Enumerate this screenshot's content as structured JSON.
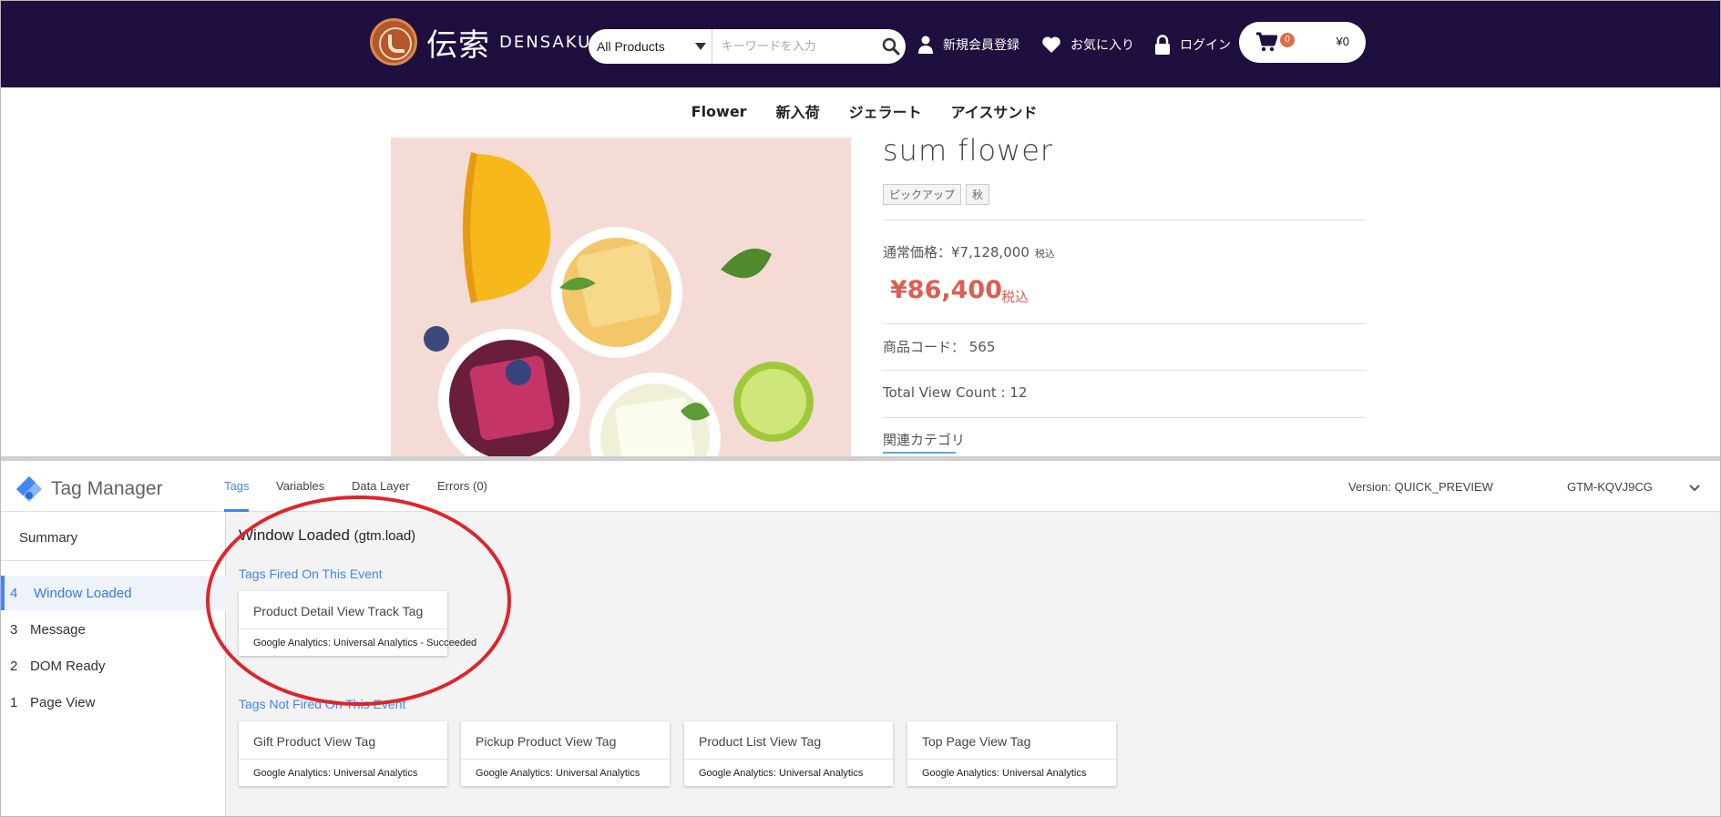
{
  "store": {
    "logo_text": "伝索",
    "logo_roman": "DENSAKU",
    "search": {
      "category": "All Products",
      "placeholder": "キーワードを入力"
    },
    "header_links": {
      "register": "新規会員登録",
      "favorites": "お気に入り",
      "login": "ログイン"
    },
    "cart": {
      "count": "0",
      "total": "¥0"
    },
    "nav": [
      "Flower",
      "新入荷",
      "ジェラート",
      "アイスサンド"
    ]
  },
  "product": {
    "name": "sum flower",
    "tags": [
      "ピックアップ",
      "秋"
    ],
    "regular_price": "通常価格：¥7,128,000",
    "regular_tax": "税込",
    "price": "¥86,400",
    "price_tax": "税込",
    "code": "商品コード： 565",
    "view_count": "Total View Count : 12",
    "related_label": "関連カテゴリ"
  },
  "gtm": {
    "title": "Tag Manager",
    "tabs": [
      "Tags",
      "Variables",
      "Data Layer",
      "Errors (0)"
    ],
    "active_tab": "Tags",
    "version": "Version: QUICK_PREVIEW",
    "container_id": "GTM-KQVJ9CG",
    "sidebar": {
      "summary": "Summary",
      "events": [
        {
          "num": "4",
          "label": "Window Loaded",
          "active": true
        },
        {
          "num": "3",
          "label": "Message"
        },
        {
          "num": "2",
          "label": "DOM Ready"
        },
        {
          "num": "1",
          "label": "Page View"
        }
      ]
    },
    "event_title": "Window Loaded",
    "event_key": "(gtm.load)",
    "fired_heading": "Tags Fired On This Event",
    "fired_tags": [
      {
        "name": "Product Detail View Track Tag",
        "detail": "Google Analytics: Universal Analytics - Succeeded"
      }
    ],
    "not_fired_heading": "Tags Not Fired On This Event",
    "not_fired_tags": [
      {
        "name": "Gift Product View Tag",
        "detail": "Google Analytics: Universal Analytics"
      },
      {
        "name": "Pickup Product View Tag",
        "detail": "Google Analytics: Universal Analytics"
      },
      {
        "name": "Product List View Tag",
        "detail": "Google Analytics: Universal Analytics"
      },
      {
        "name": "Top Page View Tag",
        "detail": "Google Analytics: Universal Analytics"
      }
    ]
  },
  "colors": {
    "header_bg": "#1e0f3e",
    "price": "#de5d50",
    "gtm_blue": "#4285f4",
    "annotation": "#e0242a"
  }
}
